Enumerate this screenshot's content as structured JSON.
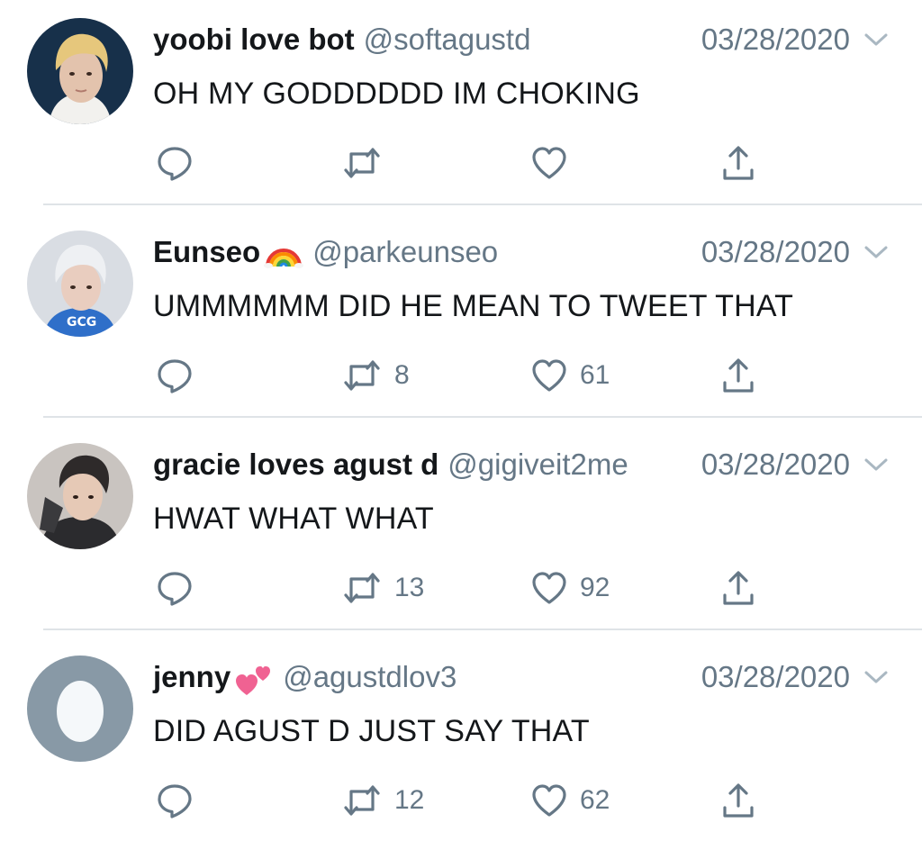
{
  "colors": {
    "text": "#14171a",
    "secondary": "#657786",
    "divider": "#dfe3e7",
    "icon": "#657786"
  },
  "tweets": [
    {
      "name": "yoobi love bot",
      "name_emoji": "",
      "handle": "@softagustd",
      "date": "03/28/2020",
      "text": "OH MY GODDDDDD IM CHOKING",
      "retweets": "",
      "likes": "",
      "avatar": "photo-blonde-hair"
    },
    {
      "name": "Eunseo",
      "name_emoji": "rainbow-icon",
      "handle": "@parkeunseo",
      "date": "03/28/2020",
      "text": "UMMMMMM DID HE MEAN TO TWEET THAT",
      "retweets": "8",
      "likes": "61",
      "avatar": "photo-silver-hair"
    },
    {
      "name": "gracie loves agust d",
      "name_emoji": "",
      "handle": "@gigiveit2me",
      "date": "03/28/2020",
      "text": "HWAT WHAT WHAT",
      "retweets": "13",
      "likes": "92",
      "avatar": "photo-dark-hair"
    },
    {
      "name": "jenny",
      "name_emoji": "two-hearts-icon",
      "handle": "@agustdlov3",
      "date": "03/28/2020",
      "text": "DID AGUST D JUST SAY THAT",
      "retweets": "12",
      "likes": "62",
      "avatar": "default-egg"
    }
  ]
}
